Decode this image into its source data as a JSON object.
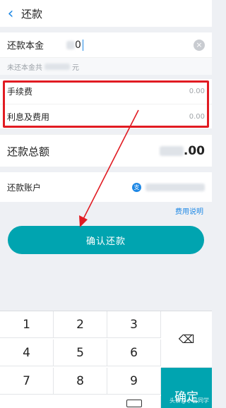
{
  "header": {
    "back_icon": "chevron-left-icon",
    "title": "还款"
  },
  "principal": {
    "label": "还款本金",
    "value_visible": "0",
    "clear_icon": "clear-circle-icon"
  },
  "hint": {
    "prefix": "未还本金共",
    "suffix": "元"
  },
  "fees": [
    {
      "label": "手续费",
      "amount": "0.00"
    },
    {
      "label": "利息及费用",
      "amount": "0.00"
    }
  ],
  "total": {
    "label": "还款总额",
    "amount_visible": ".00"
  },
  "account": {
    "label": "还款账户",
    "icon": "alipay-icon"
  },
  "fee_link": "费用说明",
  "confirm_button": "确认还款",
  "keypad": {
    "keys": [
      "1",
      "2",
      "3",
      "4",
      "5",
      "6",
      "7",
      "8",
      "9"
    ],
    "delete_icon": "backspace-icon",
    "confirm": "确定",
    "keyboard_icon": "keyboard-icon"
  },
  "watermark": "头条@小吕同学",
  "colors": {
    "accent": "#00a4b0",
    "link": "#1e88e5",
    "highlight": "#e11b22"
  }
}
